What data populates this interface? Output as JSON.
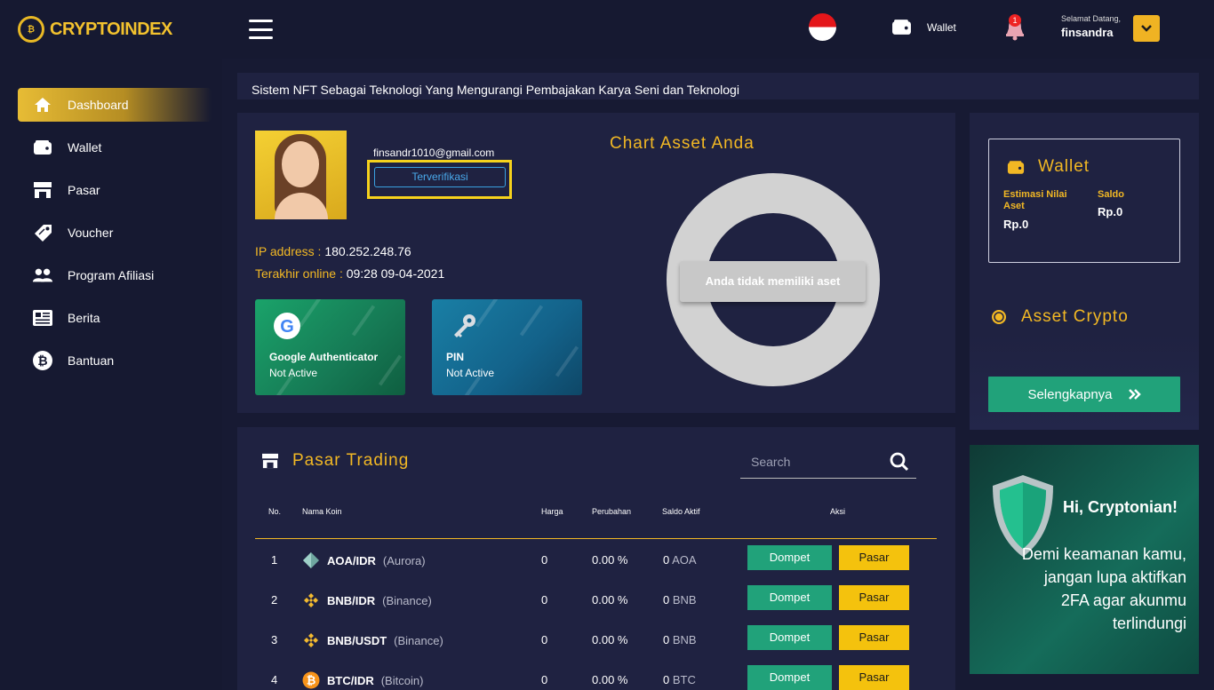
{
  "brand": {
    "name": "CRYPTOINDEX"
  },
  "sidebar": {
    "items": [
      {
        "label": "Dashboard",
        "icon": "home-icon",
        "active": true
      },
      {
        "label": "Wallet",
        "icon": "wallet-icon"
      },
      {
        "label": "Pasar",
        "icon": "store-icon"
      },
      {
        "label": "Voucher",
        "icon": "voucher-icon"
      },
      {
        "label": "Program Afiliasi",
        "icon": "users-icon"
      },
      {
        "label": "Berita",
        "icon": "news-icon"
      },
      {
        "label": "Bantuan",
        "icon": "help-icon"
      }
    ]
  },
  "header": {
    "wallet_label": "Wallet",
    "notification_count": "1",
    "greeting": "Selamat Datang,",
    "username": "finsandra"
  },
  "marquee": {
    "text": "Sistem NFT Sebagai Teknologi Yang Mengurangi Pembajakan Karya Seni dan Teknologi"
  },
  "profile": {
    "email": "finsandr1010@gmail.com",
    "status_label": "Terverifikasi",
    "ip_label": "IP address :",
    "ip_value": "180.252.248.76",
    "last_online_label": "Terakhir online :",
    "last_online_value": "09:28 09-04-2021"
  },
  "security": {
    "google": {
      "title": "Google Authenticator",
      "status": "Not Active"
    },
    "pin": {
      "title": "PIN",
      "status": "Not Active"
    }
  },
  "asset_chart": {
    "title": "Chart Asset Anda",
    "empty_message": "Anda tidak memiliki aset"
  },
  "wallet_card": {
    "title": "Wallet",
    "estimate_label": "Estimasi Nilai Aset",
    "estimate_value": "Rp.0",
    "balance_label": "Saldo",
    "balance_value": "Rp.0",
    "asset_crypto_title": "Asset Crypto",
    "more_label": "Selengkapnya"
  },
  "trading": {
    "title": "Pasar Trading",
    "search_placeholder": "Search",
    "columns": [
      "No.",
      "Nama Koin",
      "Harga",
      "Perubahan",
      "Saldo Aktif",
      "Aksi"
    ],
    "rows": [
      {
        "no": "1",
        "pair": "AOA/IDR",
        "name": "(Aurora)",
        "price": "0",
        "change": "0.00 %",
        "balance": "0",
        "unit": "AOA",
        "coin_icon": "aurora-icon"
      },
      {
        "no": "2",
        "pair": "BNB/IDR",
        "name": "(Binance)",
        "price": "0",
        "change": "0.00 %",
        "balance": "0",
        "unit": "BNB",
        "coin_icon": "binance-icon"
      },
      {
        "no": "3",
        "pair": "BNB/USDT",
        "name": "(Binance)",
        "price": "0",
        "change": "0.00 %",
        "balance": "0",
        "unit": "BNB",
        "coin_icon": "binance-icon"
      },
      {
        "no": "4",
        "pair": "BTC/IDR",
        "name": "(Bitcoin)",
        "price": "0",
        "change": "0.00 %",
        "balance": "0",
        "unit": "BTC",
        "coin_icon": "bitcoin-icon"
      }
    ],
    "wallet_button": "Dompet",
    "market_button": "Pasar"
  },
  "banner": {
    "greeting": "Hi, Cryptonian!",
    "message": "Demi keamanan kamu, jangan lupa aktifkan 2FA agar akunmu terlindungi"
  },
  "colors": {
    "accent": "#f2b824",
    "green": "#21a27a",
    "bg": "#171a33",
    "card": "#1f2241"
  }
}
